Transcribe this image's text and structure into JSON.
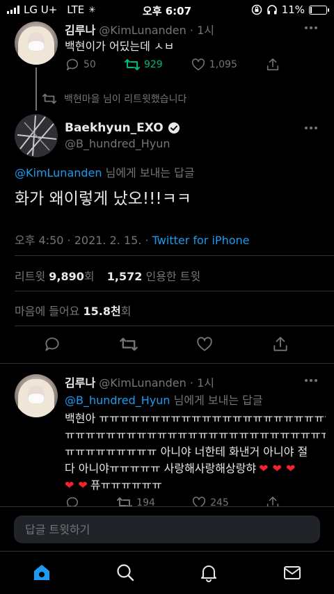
{
  "status_bar": {
    "carrier": "LG U+",
    "network": "LTE",
    "time": "오후 6:07",
    "battery": "11%",
    "battery_level": 0.11
  },
  "parent_tweet": {
    "display_name": "김루나",
    "handle": "@KimLunanden",
    "time_ago": "· 1시",
    "text": "백현이가 어딨는데 ㅅㅂ",
    "replies": "50",
    "retweets": "929",
    "likes": "1,095"
  },
  "retweet_notice": "백현마을 님이 리트윗했습니다",
  "main_tweet": {
    "display_name": "Baekhyun_EXO",
    "handle": "@B_hundred_Hyun",
    "reply_to_handle": "@KimLunanden",
    "reply_to_suffix": " 님에게 보내는 답글",
    "text": "화가 왜이렇게 났오!!!ㅋㅋ",
    "timestamp": "오후 4:50 · 2021. 2. 15. · ",
    "source": "Twitter for iPhone",
    "retweet_label": "리트윗 ",
    "retweet_count": "9,890",
    "retweet_unit": "회",
    "quote_count": "1,572",
    "quote_label": " 인용한 트윗",
    "likes_label": "마음에 들어요 ",
    "likes_count": "15.8천",
    "likes_unit": "회"
  },
  "reply_tweet": {
    "display_name": "김루나",
    "handle": "@KimLunanden",
    "time_ago": "· 1시",
    "reply_to_handle": "@B_hundred_Hyun",
    "reply_to_suffix": " 님에게 보내는 답글",
    "text_line1": "백현아 ㅠㅠㅠㅠㅠㅠㅠㅠㅠㅠㅠㅠㅠㅠㅠㅠㅠㅠㅠㅠㅠㅠㅠ",
    "text_line2": "ㅠㅠㅠㅠㅠㅠㅠㅠㅠㅠㅠㅠㅠㅠㅠㅠㅠㅠㅠㅠㅠㅠㅠㅠㅠㅠㅠ",
    "text_line3": "ㅠㅠㅠㅠㅠㅠㅠㅠㅠ 아니야 너한테 화낸거 아니야 절",
    "text_line4": "다 아니야ㅠㅠㅠㅠㅠ 사랑해사랑해상랑햐",
    "text_line5": "퓨ㅠㅠㅠㅠㅠㅠ",
    "retweets": "194",
    "likes": "245"
  },
  "reply_bar": {
    "placeholder": "답글 트윗하기"
  },
  "colors": {
    "accent": "#1d9bf0",
    "retweet_green": "#00ba7c",
    "heart_red": "#f4212e"
  },
  "icons": [
    "reply-icon",
    "retweet-icon",
    "like-icon",
    "share-icon",
    "more-icon",
    "verified-icon",
    "home-icon",
    "search-icon",
    "notifications-icon",
    "messages-icon"
  ]
}
